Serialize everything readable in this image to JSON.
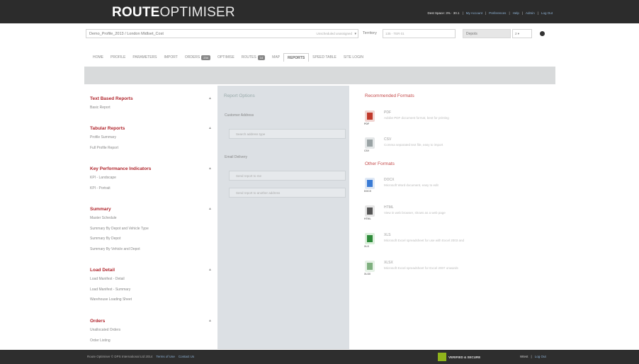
{
  "app": {
    "logo_bold": "ROUTE",
    "logo_light": "OPTIMISER",
    "top_right": {
      "user": "Dest Space: 3% · 30.1",
      "account": "My Account",
      "preferences": "Preferences",
      "help": "Help",
      "admin": "Admin",
      "logout": "Log Out"
    }
  },
  "search_row": {
    "plan": "Demo_Profile_2013 / London Midlset_Cost",
    "plan_hint": "Unscheduled unassigned",
    "territory_label": "Territory",
    "territory_value": "135 · TER 01",
    "depots_label": "Depots",
    "depots_value": "2"
  },
  "tabs": [
    {
      "label": "HOME"
    },
    {
      "label": "PROFILE"
    },
    {
      "label": "PARAMETERS"
    },
    {
      "label": "IMPORT"
    },
    {
      "label": "ORDERS",
      "badge": "234"
    },
    {
      "label": "OPTIMISE"
    },
    {
      "label": "ROUTES",
      "badge": "14"
    },
    {
      "label": "MAP"
    },
    {
      "label": "REPORTS",
      "active": true
    },
    {
      "label": "SPEED TABLE"
    },
    {
      "label": "SITE LOGIN"
    }
  ],
  "reports": {
    "sections": [
      {
        "title": "Text Based Reports",
        "items": [
          "Basic Report"
        ]
      },
      {
        "title": "Tabular Reports",
        "items": [
          "Profile Summary",
          "Full Profile Report"
        ]
      },
      {
        "title": "Key Performance Indicators",
        "items": [
          "KPI - Landscape",
          "KPI - Portrait"
        ]
      },
      {
        "title": "Summary",
        "items": [
          "Master Schedule",
          "Summary By Depot and Vehicle Type",
          "Summary By Depot",
          "Summary By Vehicle and Depot"
        ]
      },
      {
        "title": "Load Detail",
        "items": [
          "Load Manifest - Detail",
          "Load Manifest - Summary",
          "Warehouse Loading Sheet"
        ]
      },
      {
        "title": "Orders",
        "items": [
          "Unallocated Orders",
          "Order Listing"
        ]
      }
    ]
  },
  "options": {
    "title": "Report Options",
    "customer_label": "Customer Address",
    "customer_placeholder": "Search address type",
    "email_label": "Email Delivery",
    "email_self": "Send report to me",
    "email_other": "Send report to another address"
  },
  "formats": {
    "recommended_title": "Recommended Formats",
    "other_title": "Other Formats",
    "recommended": [
      {
        "name": "PDF",
        "desc": "Adobe PDF document format, best for printing",
        "tag": "PDF",
        "color": "#c0392b",
        "icon": "pdf-icon"
      },
      {
        "name": "CSV",
        "desc": "Comma separated text file, easy to import",
        "tag": "CSV",
        "color": "#7f8c8d",
        "icon": "csv-icon"
      }
    ],
    "other": [
      {
        "name": "DOCX",
        "desc": "Microsoft Word document, easy to edit",
        "tag": "DOCX",
        "color": "#3a7bd5",
        "icon": "docx-icon"
      },
      {
        "name": "HTML",
        "desc": "View in web browser, shows as a web page",
        "tag": "HTML",
        "color": "#555555",
        "icon": "html-icon"
      },
      {
        "name": "XLS",
        "desc": "Microsoft Excel spreadsheet for use with Excel 2003 and",
        "tag": "XLS",
        "color": "#2e8b3a",
        "icon": "xls-icon"
      },
      {
        "name": "XLSX",
        "desc": "Microsoft Excel spreadsheet for Excel 2007 onwards",
        "tag": "XLSX",
        "color": "#7fb07f",
        "icon": "xlsx-icon"
      }
    ]
  },
  "footer": {
    "copyright": "Route Optimiser © DPS International Ltd 2014",
    "terms": "Terms of Use",
    "contact": "Contact Us",
    "badge_text": "VERIFIED & SECURE",
    "user": "Wtest",
    "logout": "Log Out"
  }
}
